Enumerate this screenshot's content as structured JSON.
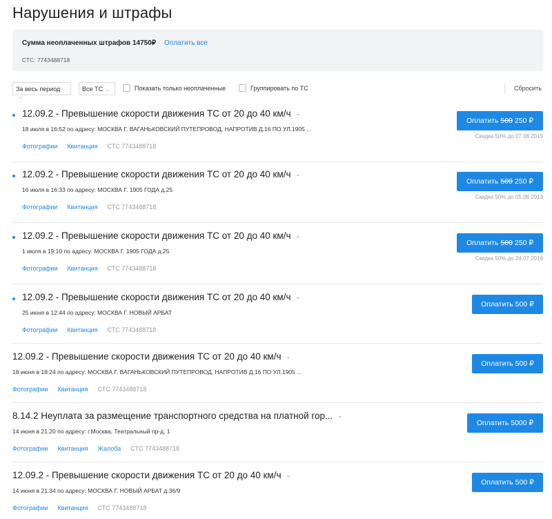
{
  "page": {
    "title": "Нарушения и штрафы"
  },
  "summary": {
    "total_label": "Сумма неоплаченных штрафов 14750₽",
    "pay_all": "Оплатить все",
    "sts": "СТС: 7743488718"
  },
  "filters": {
    "period": "За весь период",
    "vehicle": "Все ТС",
    "only_unpaid": "Показать только неоплаченные",
    "group_by_vehicle": "Группировать по ТС",
    "reset": "Сбросить"
  },
  "fines": [
    {
      "unread": true,
      "title": "12.09.2 - Превышение скорости движения ТС от 20 до 40 км/ч",
      "address": "18 июля в 16:52 по адресу: МОСКВА Г. ВАГАНЬКОВСКИЙ ПУТЕПРОВОД, НАПРОТИВ Д.16 ПО УЛ.1905 ...",
      "links": [
        "Фотографии",
        "Квитанция"
      ],
      "sts": "СТС 7743488718",
      "pay_prefix": "Оплатить",
      "old_price": "500",
      "price": "250 ₽",
      "discount": "Скидка 50% до 07.08.2019"
    },
    {
      "unread": true,
      "title": "12.09.2 - Превышение скорости движения ТС от 20 до 40 км/ч",
      "address": "16 июля в 16:33 по адресу: МОСКВА Г. 1905 ГОДА д.25",
      "links": [
        "Фотографии",
        "Квитанция"
      ],
      "sts": "СТС 7743488718",
      "pay_prefix": "Оплатить",
      "old_price": "500",
      "price": "250 ₽",
      "discount": "Скидка 50% до 05.08.2019"
    },
    {
      "unread": true,
      "title": "12.09.2 - Превышение скорости движения ТС от 20 до 40 км/ч",
      "address": "1 июля в 19:10 по адресу: МОСКВА Г. 1905 ГОДА д.25",
      "links": [
        "Фотографии",
        "Квитанция"
      ],
      "sts": "СТС 7743488718",
      "pay_prefix": "Оплатить",
      "old_price": "500",
      "price": "250 ₽",
      "discount": "Скидка 50% до 24.07.2019"
    },
    {
      "unread": true,
      "title": "12.09.2 - Превышение скорости движения ТС от 20 до 40 км/ч",
      "address": "25 июня в 12:44 по адресу: МОСКВА Г. НОВЫЙ АРБАТ",
      "links": [
        "Фотографии",
        "Квитанция"
      ],
      "sts": "СТС 7743488718",
      "pay_label": "Оплатить 500 ₽"
    },
    {
      "unread": false,
      "title": "12.09.2 - Превышение скорости движения ТС от 20 до 40 км/ч",
      "address": "18 июня в 18:24 по адресу: МОСКВА Г. ВАГАНЬКОВСКИЙ ПУТЕПРОВОД, НАПРОТИВ Д.16 ПО УЛ.1905 ...",
      "links": [
        "Фотографии",
        "Квитанция"
      ],
      "sts": "СТС 7743488718",
      "pay_label": "Оплатить 500 ₽"
    },
    {
      "unread": false,
      "title": "8.14.2 Неуплата за размещение транспортного средства на платной гор...",
      "address": "14 июня в 21:20 по адресу: г.Москва, Театральный пр-д, 1",
      "links": [
        "Фотографии",
        "Квитанция",
        "Жалоба"
      ],
      "sts": "СТС 7743488718",
      "pay_label": "Оплатить 5000 ₽"
    },
    {
      "unread": false,
      "title": "12.09.2 - Превышение скорости движения ТС от 20 до 40 км/ч",
      "address": "14 июня в 21:34 по адресу: МОСКВА Г. НОВЫЙ АРБАТ д.36/9",
      "links": [
        "Фотографии",
        "Квитанция"
      ],
      "sts": "СТС 7743488718",
      "pay_label": "Оплатить 500 ₽"
    }
  ]
}
